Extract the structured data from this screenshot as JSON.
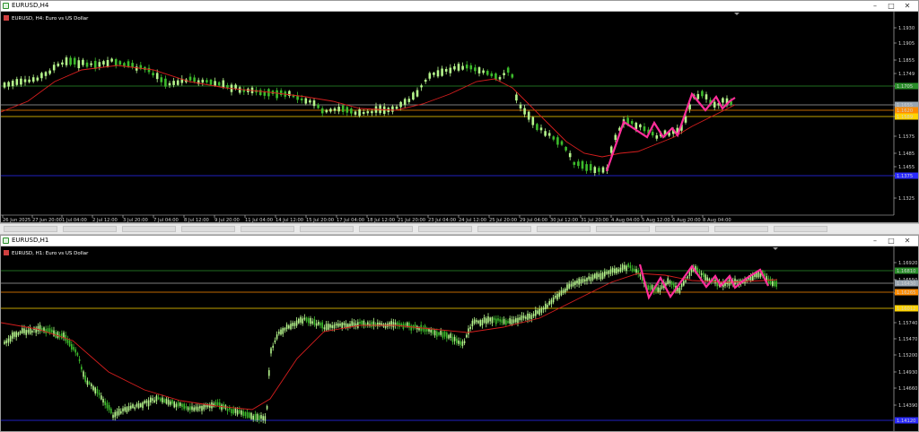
{
  "colors": {
    "background": "#000000",
    "bull_candle": "#b5f58c",
    "bear_candle": "#3dbb2c",
    "moving_average": "#d61e1e",
    "zigzag": "#ff2e9a",
    "line_green": "#2a8f2a",
    "line_grey": "#a7a7a7",
    "line_orange": "#ff8c00",
    "line_yellow": "#ffd400",
    "line_blue": "#2b2bff"
  },
  "top_window": {
    "title": "EURUSD,H4",
    "symbol_label": "EURUSD, H4:  Euro vs US Dollar",
    "price_labels": [
      "1.1930",
      "1.1905",
      "1.1855",
      "1.1749",
      "1.1705",
      "1.1655",
      "1.1605",
      "1.1575",
      "1.1485",
      "1.1455",
      "1.1375",
      "1.1325"
    ],
    "price_tags": [
      "1.1705",
      "1.1655",
      "1.1620",
      "1.1589",
      "1.1375"
    ],
    "time_labels": [
      "26 Jun 2025",
      "27 Jun 20:00",
      "1 Jul 04:00",
      "2 Jul 12:00",
      "3 Jul 20:00",
      "7 Jul 04:00",
      "8 Jul 12:00",
      "9 Jul 20:00",
      "11 Jul 04:00",
      "14 Jul 12:00",
      "15 Jul 20:00",
      "17 Jul 04:00",
      "18 Jul 12:00",
      "21 Jul 20:00",
      "23 Jul 04:00",
      "24 Jul 12:00",
      "25 Jul 20:00",
      "29 Jul 04:00",
      "30 Jul 12:00",
      "31 Jul 20:00",
      "4 Aug 04:00",
      "5 Aug 12:00",
      "6 Aug 20:00",
      "8 Aug 04:00"
    ]
  },
  "bottom_window": {
    "title": "EURUSD,H1",
    "symbol_label": "EURUSD, H1:  Euro vs US Dollar",
    "price_labels": [
      "1.16920",
      "1.16550",
      "1.16180",
      "1.15740",
      "1.15470",
      "1.15200",
      "1.14930",
      "1.14660",
      "1.14390"
    ],
    "price_tags": [
      "1.16810",
      "1.16430",
      "1.16265",
      "1.16012",
      "1.14120"
    ]
  }
}
